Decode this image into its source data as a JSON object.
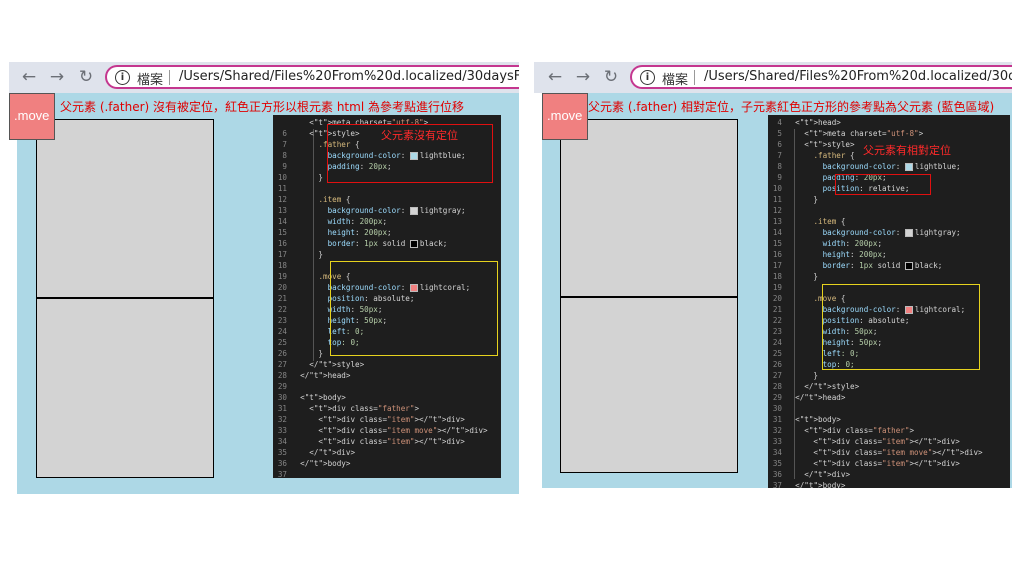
{
  "left": {
    "browser": {
      "back_icon": "←",
      "forward_icon": "→",
      "reload_icon": "↻",
      "info_icon": "i",
      "address_label": "檔案",
      "address_url": "/Users/Shared/Files%20From%20d.localized/30daysForFE/"
    },
    "caption": "父元素 (.father) 沒有被定位，紅色正方形以根元素 html 為參考點進行位移",
    "move_label": ".move",
    "annotation_text": "父元素沒有定位",
    "code_lines": [
      {
        "num": "",
        "text": "    <meta charset=\"utf-8\">"
      },
      {
        "num": "6",
        "text": "    <style>"
      },
      {
        "num": "7",
        "text": "      .father {"
      },
      {
        "num": "8",
        "text": "        background-color: lightblue;"
      },
      {
        "num": "9",
        "text": "        padding: 20px;"
      },
      {
        "num": "10",
        "text": "      }"
      },
      {
        "num": "11",
        "text": ""
      },
      {
        "num": "12",
        "text": "      .item {"
      },
      {
        "num": "13",
        "text": "        background-color: lightgray;"
      },
      {
        "num": "14",
        "text": "        width: 200px;"
      },
      {
        "num": "15",
        "text": "        height: 200px;"
      },
      {
        "num": "16",
        "text": "        border: 1px solid black;"
      },
      {
        "num": "17",
        "text": "      }"
      },
      {
        "num": "18",
        "text": ""
      },
      {
        "num": "19",
        "text": "      .move {"
      },
      {
        "num": "20",
        "text": "        background-color: lightcoral;"
      },
      {
        "num": "21",
        "text": "        position: absolute;"
      },
      {
        "num": "22",
        "text": "        width: 50px;"
      },
      {
        "num": "23",
        "text": "        height: 50px;"
      },
      {
        "num": "24",
        "text": "        left: 0;"
      },
      {
        "num": "25",
        "text": "        top: 0;"
      },
      {
        "num": "26",
        "text": "      }"
      },
      {
        "num": "27",
        "text": "    </style>"
      },
      {
        "num": "28",
        "text": "  </head>"
      },
      {
        "num": "29",
        "text": ""
      },
      {
        "num": "30",
        "text": "  <body>"
      },
      {
        "num": "31",
        "text": "    <div class=\"father\">"
      },
      {
        "num": "32",
        "text": "      <div class=\"item\"></div>"
      },
      {
        "num": "33",
        "text": "      <div class=\"item move\"></div>"
      },
      {
        "num": "34",
        "text": "      <div class=\"item\"></div>"
      },
      {
        "num": "35",
        "text": "    </div>"
      },
      {
        "num": "36",
        "text": "  </body>"
      },
      {
        "num": "37",
        "text": ""
      },
      {
        "num": "38",
        "text": "</html>"
      }
    ]
  },
  "right": {
    "browser": {
      "back_icon": "←",
      "forward_icon": "→",
      "reload_icon": "↻",
      "info_icon": "i",
      "address_label": "檔案",
      "address_url": "/Users/Shared/Files%20From%20d.localized/30daysForFE/"
    },
    "caption": "父元素 (.father) 相對定位，子元素紅色正方形的參考點為父元素 (藍色區域)",
    "move_label": ".move",
    "annotation_text": "父元素有相對定位",
    "code_lines": [
      {
        "num": "4",
        "text": "  <head>"
      },
      {
        "num": "5",
        "text": "    <meta charset=\"utf-8\">"
      },
      {
        "num": "6",
        "text": "    <style>"
      },
      {
        "num": "7",
        "text": "      .father {"
      },
      {
        "num": "8",
        "text": "        background-color: lightblue;"
      },
      {
        "num": "9",
        "text": "        padding: 20px;"
      },
      {
        "num": "10",
        "text": "        position: relative;"
      },
      {
        "num": "11",
        "text": "      }"
      },
      {
        "num": "12",
        "text": ""
      },
      {
        "num": "13",
        "text": "      .item {"
      },
      {
        "num": "14",
        "text": "        background-color: lightgray;"
      },
      {
        "num": "15",
        "text": "        width: 200px;"
      },
      {
        "num": "16",
        "text": "        height: 200px;"
      },
      {
        "num": "17",
        "text": "        border: 1px solid black;"
      },
      {
        "num": "18",
        "text": "      }"
      },
      {
        "num": "19",
        "text": ""
      },
      {
        "num": "20",
        "text": "      .move {"
      },
      {
        "num": "21",
        "text": "        background-color: lightcoral;"
      },
      {
        "num": "22",
        "text": "        position: absolute;"
      },
      {
        "num": "23",
        "text": "        width: 50px;"
      },
      {
        "num": "24",
        "text": "        height: 50px;"
      },
      {
        "num": "25",
        "text": "        left: 0;"
      },
      {
        "num": "26",
        "text": "        top: 0;"
      },
      {
        "num": "27",
        "text": "      }"
      },
      {
        "num": "28",
        "text": "    </style>"
      },
      {
        "num": "29",
        "text": "  </head>"
      },
      {
        "num": "30",
        "text": ""
      },
      {
        "num": "31",
        "text": "  <body>"
      },
      {
        "num": "32",
        "text": "    <div class=\"father\">"
      },
      {
        "num": "33",
        "text": "      <div class=\"item\"></div>"
      },
      {
        "num": "34",
        "text": "      <div class=\"item move\"></div>"
      },
      {
        "num": "35",
        "text": "      <div class=\"item\"></div>"
      },
      {
        "num": "36",
        "text": "    </div>"
      },
      {
        "num": "37",
        "text": "  </body>"
      }
    ]
  },
  "colors": {
    "lightblue": "#add8e6",
    "lightgray": "#d3d3d3",
    "lightcoral": "#f08080",
    "annotation_red": "#e01010",
    "annotation_yellow": "#e6d21e"
  }
}
